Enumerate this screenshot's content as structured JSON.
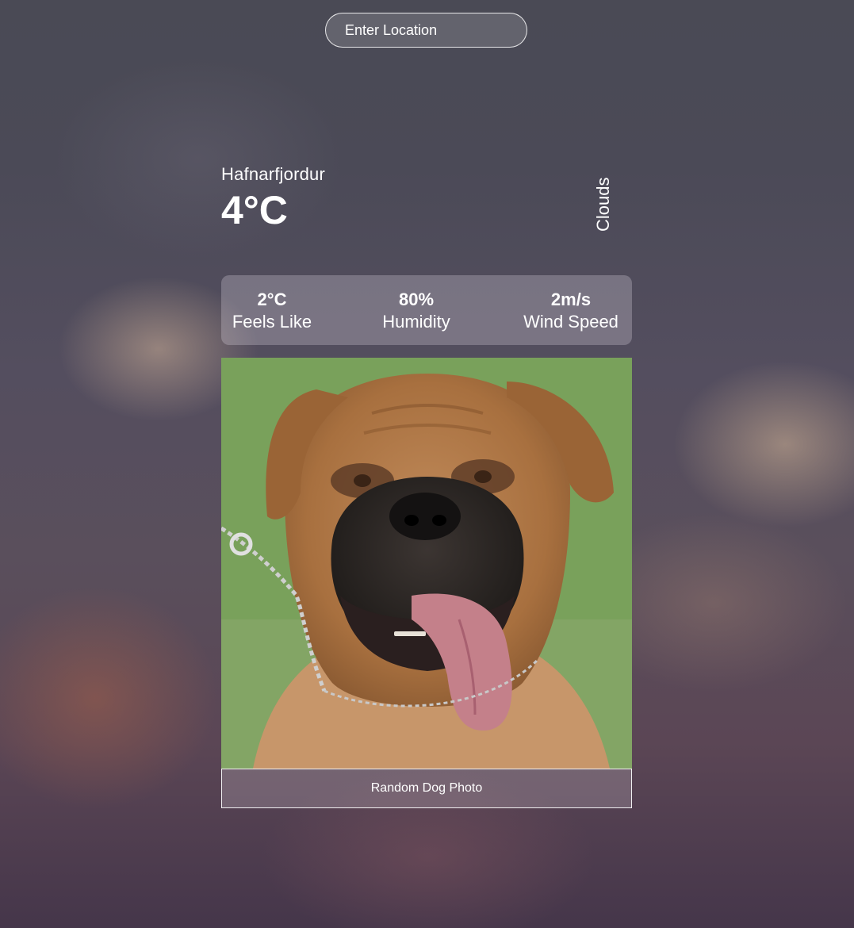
{
  "search": {
    "placeholder": "Enter Location"
  },
  "weather": {
    "city": "Hafnarfjordur",
    "temperature": "4°C",
    "description": "Clouds"
  },
  "stats": [
    {
      "value": "2°C",
      "label": "Feels Like"
    },
    {
      "value": "80%",
      "label": "Humidity"
    },
    {
      "value": "2m/s",
      "label": "Wind Speed"
    }
  ],
  "photo": {
    "button_label": "Random Dog Photo"
  }
}
